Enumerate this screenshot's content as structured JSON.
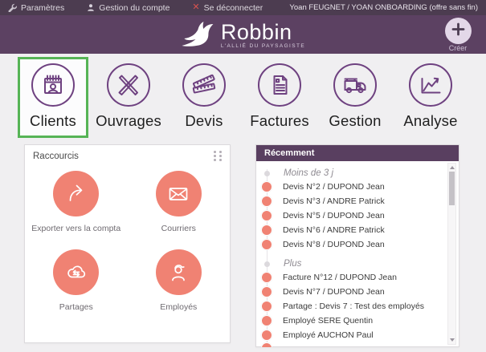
{
  "topbar": {
    "params_label": "Paramètres",
    "account_label": "Gestion du compte",
    "logout_label": "Se déconnecter",
    "user_info": "Yoan FEUGNET / YOAN ONBOARDING (offre sans fin)"
  },
  "header": {
    "brand": "Robbin",
    "tagline": "L'ALLIÉ DU PAYSAGISTE",
    "create_label": "Créer"
  },
  "nav": {
    "items": [
      {
        "label": "Clients",
        "icon": "calendar-person-icon",
        "active": true
      },
      {
        "label": "Ouvrages",
        "icon": "shears-icon",
        "active": false
      },
      {
        "label": "Devis",
        "icon": "folding-ruler-icon",
        "active": false
      },
      {
        "label": "Factures",
        "icon": "invoice-icon",
        "active": false
      },
      {
        "label": "Gestion",
        "icon": "truck-icon",
        "active": false
      },
      {
        "label": "Analyse",
        "icon": "chart-arrow-icon",
        "active": false
      }
    ]
  },
  "shortcuts": {
    "title": "Raccourcis",
    "items": [
      {
        "label": "Exporter vers la compta",
        "icon": "share-arrow-icon"
      },
      {
        "label": "Courriers",
        "icon": "envelope-icon"
      },
      {
        "label": "Partages",
        "icon": "cloud-sync-icon"
      },
      {
        "label": "Employés",
        "icon": "employee-icon"
      }
    ]
  },
  "recent": {
    "title": "Récemment",
    "groups": [
      {
        "label": "Moins de 3 j",
        "items": [
          "Devis N°2 / DUPOND Jean",
          "Devis N°3 / ANDRE Patrick",
          "Devis N°5 / DUPOND Jean",
          "Devis N°6 / ANDRE Patrick",
          "Devis N°8 / DUPOND Jean"
        ]
      },
      {
        "label": "Plus",
        "items": [
          "Facture N°12 / DUPOND Jean",
          "Devis N°7 / DUPOND Jean",
          "Partage : Devis 7 : Test des employés",
          "Employé SERE Quentin",
          "Employé AUCHON Paul"
        ]
      }
    ]
  },
  "colors": {
    "page-bg": "#f0eff1",
    "topbar-bg": "#4c3c50",
    "header-bg": "#5c4162",
    "accent": "#6e4180",
    "recent-bg": "#593f60",
    "coral": "#f08273",
    "green": "#56b456",
    "red": "#d9534f"
  }
}
